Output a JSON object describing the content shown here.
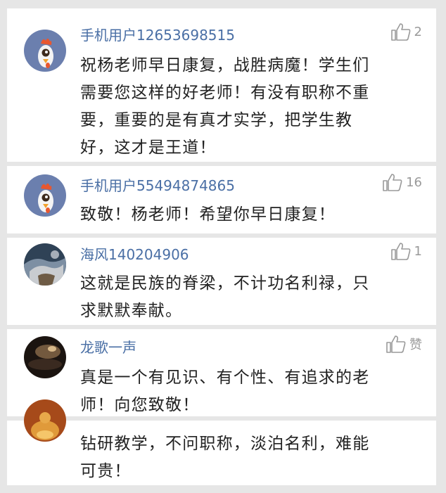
{
  "colors": {
    "username": "#4a6fa5",
    "text": "#222222",
    "muted": "#9a9a9a",
    "background": "#e6e6e6",
    "card": "#ffffff"
  },
  "comments": [
    {
      "username": "手机用户12653698515",
      "likes": "2",
      "avatar_icon": "rooster-icon",
      "content": "祝杨老师早日康复，战胜病魔！学生们\n需要您这样的好老师！有没有职称不重\n要，重要的是有真才实学，把学生教\n好，这才是王道！"
    },
    {
      "username": "手机用户55494874865",
      "likes": "16",
      "avatar_icon": "rooster-icon",
      "content": "致敬！杨老师！希望你早日康复！"
    },
    {
      "username": "海风140204906",
      "likes": "1",
      "avatar_icon": "landscape-photo-avatar",
      "content": "这就是民族的脊梁，不计功名利禄，只\n求默默奉献。"
    },
    {
      "username": "龙歌一声",
      "likes": "赞",
      "avatar_icon": "dark-photo-avatar",
      "content": "真是一个有见识、有个性、有追求的老\n师！向您致敬！"
    },
    {
      "username": "",
      "likes": "",
      "avatar_icon": "buddha-photo-avatar",
      "content": "钻研教学，不问职称，淡泊名利，难能\n可贵！"
    }
  ]
}
